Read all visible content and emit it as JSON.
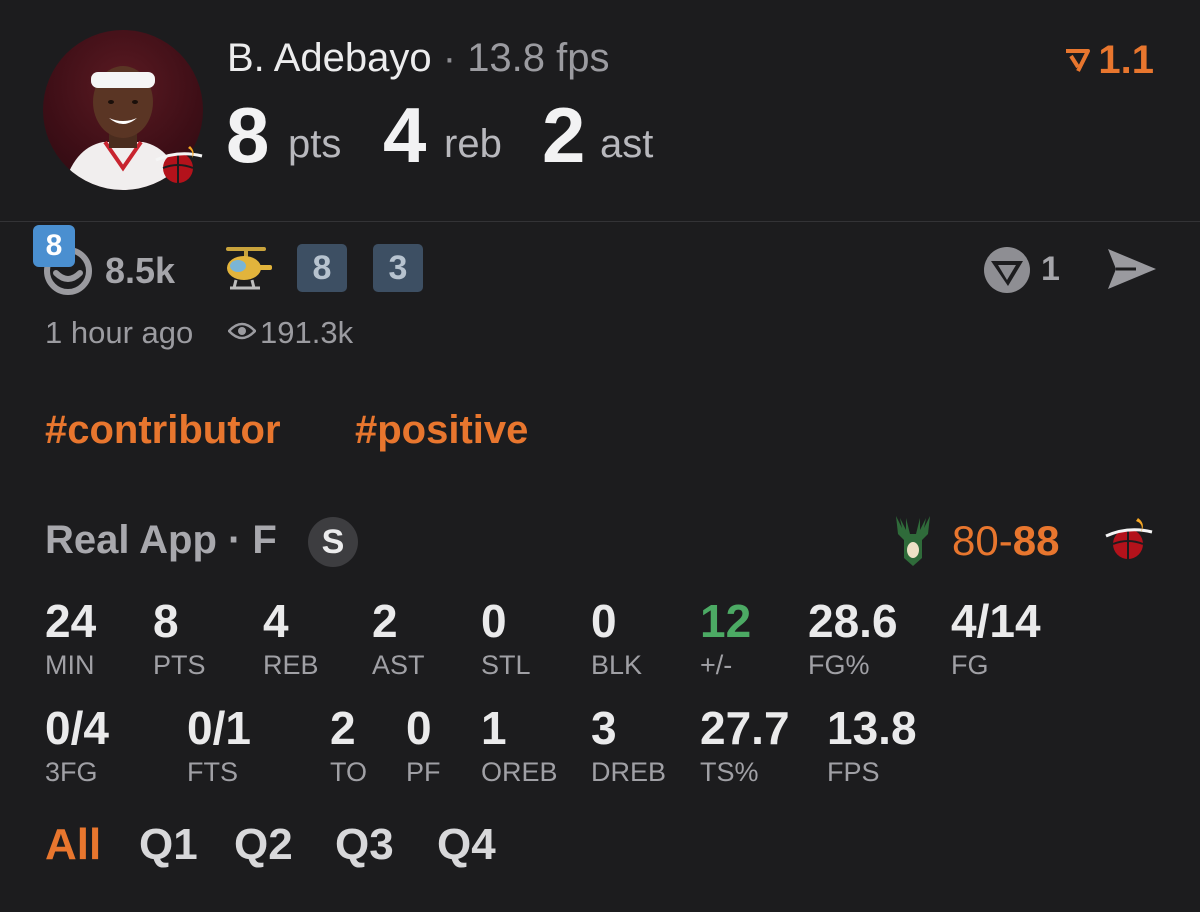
{
  "header": {
    "player_name": "B. Adebayo",
    "separator": "·",
    "fps_text": "13.8 fps",
    "stats": [
      {
        "value": "8",
        "unit": "pts"
      },
      {
        "value": "4",
        "unit": "reb"
      },
      {
        "value": "2",
        "unit": "ast"
      }
    ],
    "rating": "1.1",
    "avatar_icon": "player-photo",
    "team_icon": "heat-logo-icon"
  },
  "reactions": {
    "rank_badge": "8",
    "reaction_count": "8.5k",
    "badge_a": "8",
    "badge_b": "3",
    "v_count": "1",
    "icons": [
      "smiley-reaction-icon",
      "helicopter-icon",
      "v-vote-icon",
      "send-icon",
      "eye-icon"
    ]
  },
  "meta": {
    "time_ago": "1 hour ago",
    "views": "191.3k"
  },
  "tags": [
    "#contributor",
    "#positive"
  ],
  "game": {
    "label": "Real App · F",
    "s_badge": "S",
    "score_opp": "80",
    "score_dash": "-",
    "score_own": "88"
  },
  "stat_row_1": [
    {
      "value": "24",
      "label": "MIN"
    },
    {
      "value": "8",
      "label": "PTS"
    },
    {
      "value": "4",
      "label": "REB"
    },
    {
      "value": "2",
      "label": "AST"
    },
    {
      "value": "0",
      "label": "STL"
    },
    {
      "value": "0",
      "label": "BLK"
    },
    {
      "value": "12",
      "label": "+/-"
    },
    {
      "value": "28.6",
      "label": "FG%"
    },
    {
      "value": "4/14",
      "label": "FG"
    }
  ],
  "stat_row_2": [
    {
      "value": "0/4",
      "label": "3FG"
    },
    {
      "value": "0/1",
      "label": "FTS"
    },
    {
      "value": "2",
      "label": "TO"
    },
    {
      "value": "0",
      "label": "PF"
    },
    {
      "value": "1",
      "label": "OREB"
    },
    {
      "value": "3",
      "label": "DREB"
    },
    {
      "value": "27.7",
      "label": "TS%"
    },
    {
      "value": "13.8",
      "label": "FPS"
    }
  ],
  "quarter_tabs": [
    "All",
    "Q1",
    "Q2",
    "Q3",
    "Q4"
  ],
  "colors": {
    "accent": "#e8762e",
    "background": "#1c1c1e",
    "positive": "#4caa64",
    "rank_badge": "#4a8fd0"
  }
}
